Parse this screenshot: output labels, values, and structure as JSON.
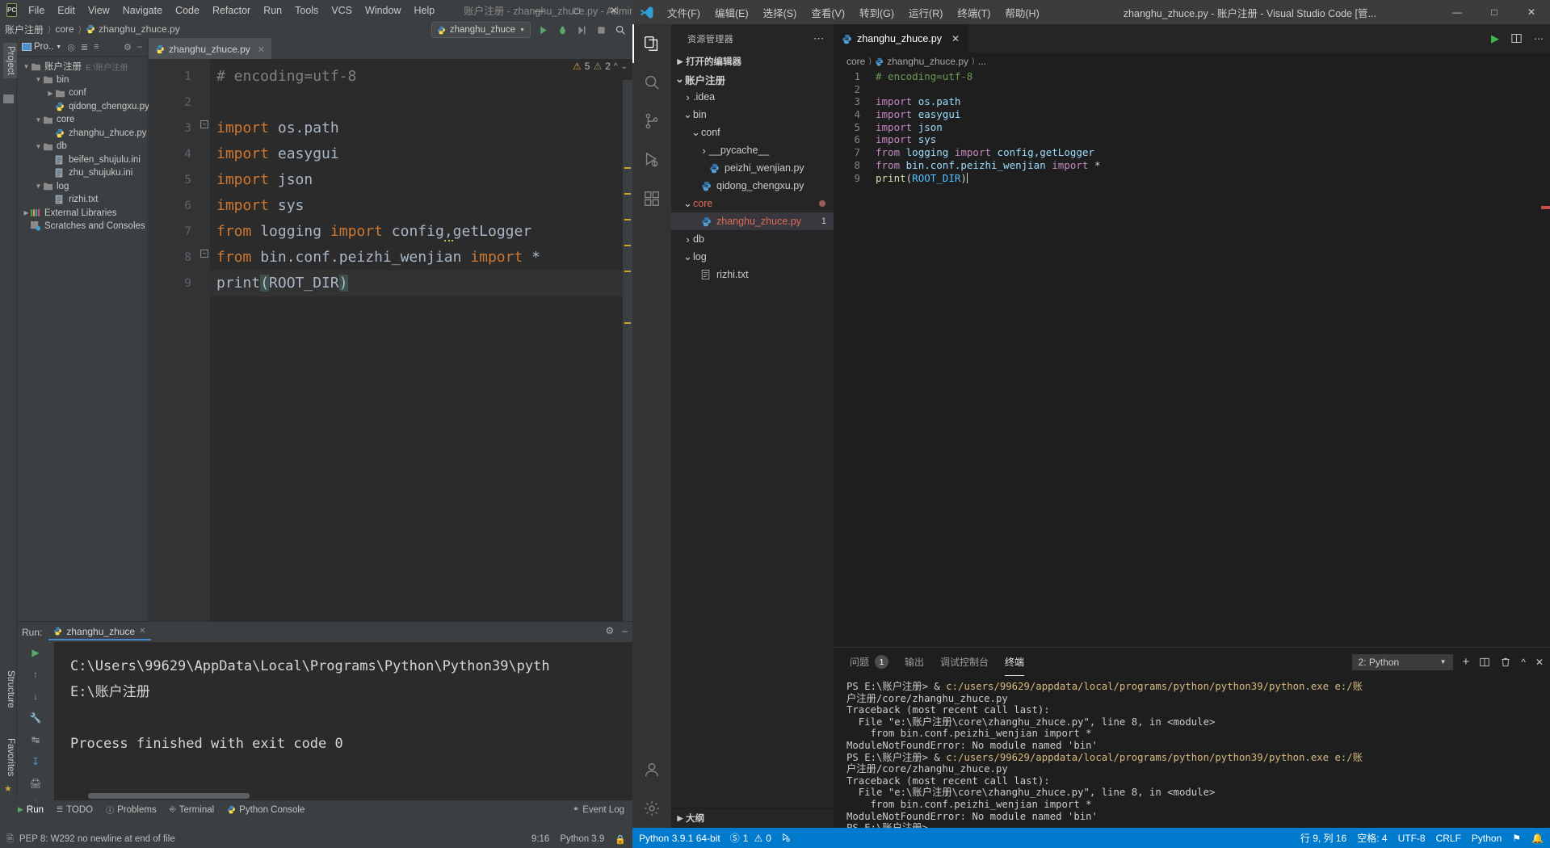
{
  "pycharm": {
    "menu": [
      "File",
      "Edit",
      "View",
      "Navigate",
      "Code",
      "Refactor",
      "Run",
      "Tools",
      "VCS",
      "Window",
      "Help"
    ],
    "title": "账户注册 - zhanghu_zhuce.py - Administrator",
    "breadcrumb": [
      "账户注册",
      "core",
      "zhanghu_zhuce.py"
    ],
    "run_config": "zhanghu_zhuce",
    "project_panel": {
      "title": "Pro.."
    },
    "tree": [
      {
        "indent": 0,
        "arrow": "v",
        "icon": "folder",
        "label": "账户注册",
        "sub": "E:\\账户注册"
      },
      {
        "indent": 1,
        "arrow": "v",
        "icon": "folder",
        "label": "bin",
        "sub": ""
      },
      {
        "indent": 2,
        "arrow": ">",
        "icon": "folder",
        "label": "conf",
        "sub": ""
      },
      {
        "indent": 2,
        "arrow": "",
        "icon": "py",
        "label": "qidong_chengxu.py",
        "sub": ""
      },
      {
        "indent": 1,
        "arrow": "v",
        "icon": "folder",
        "label": "core",
        "sub": ""
      },
      {
        "indent": 2,
        "arrow": "",
        "icon": "py",
        "label": "zhanghu_zhuce.py",
        "sub": ""
      },
      {
        "indent": 1,
        "arrow": "v",
        "icon": "folder",
        "label": "db",
        "sub": ""
      },
      {
        "indent": 2,
        "arrow": "",
        "icon": "ini",
        "label": "beifen_shujulu.ini",
        "sub": ""
      },
      {
        "indent": 2,
        "arrow": "",
        "icon": "ini",
        "label": "zhu_shujuku.ini",
        "sub": ""
      },
      {
        "indent": 1,
        "arrow": "v",
        "icon": "folder",
        "label": "log",
        "sub": ""
      },
      {
        "indent": 2,
        "arrow": "",
        "icon": "ini",
        "label": "rizhi.txt",
        "sub": ""
      },
      {
        "indent": 0,
        "arrow": ">",
        "icon": "lib",
        "label": "External Libraries",
        "sub": ""
      },
      {
        "indent": 0,
        "arrow": "",
        "icon": "scratch",
        "label": "Scratches and Consoles",
        "sub": ""
      }
    ],
    "vertical_tabs": {
      "project": "Project",
      "structure": "Structure",
      "favorites": "Favorites"
    },
    "editor_tab": "zhanghu_zhuce.py",
    "inspections": {
      "warnings": "5",
      "weak_warnings": "2"
    },
    "code_lines": [
      {
        "n": "1",
        "text": "# encoding=utf-8",
        "kind": "comment"
      },
      {
        "n": "2",
        "text": "",
        "kind": "blank"
      },
      {
        "n": "3",
        "text": "import os.path",
        "kind": "import"
      },
      {
        "n": "4",
        "text": "import easygui",
        "kind": "import"
      },
      {
        "n": "5",
        "text": "import json",
        "kind": "import"
      },
      {
        "n": "6",
        "text": "import sys",
        "kind": "import"
      },
      {
        "n": "7",
        "text": "from logging import config,getLogger",
        "kind": "fromimport"
      },
      {
        "n": "8",
        "text": "from bin.conf.peizhi_wenjian import *",
        "kind": "fromimport2"
      },
      {
        "n": "9",
        "text": "print(ROOT_DIR)",
        "kind": "call"
      }
    ],
    "run_panel": {
      "label": "Run:",
      "tab": "zhanghu_zhuce",
      "console": [
        "C:\\Users\\99629\\AppData\\Local\\Programs\\Python\\Python39\\pyth",
        "E:\\账户注册",
        "",
        "Process finished with exit code 0"
      ]
    },
    "tool_windows": [
      "Run",
      "TODO",
      "Problems",
      "Terminal",
      "Python Console"
    ],
    "event_log": "Event Log",
    "status": {
      "message": "PEP 8: W292 no newline at end of file",
      "position": "9:16",
      "interpreter": "Python 3.9"
    }
  },
  "vscode": {
    "menu": [
      "文件(F)",
      "编辑(E)",
      "选择(S)",
      "查看(V)",
      "转到(G)",
      "运行(R)",
      "终端(T)",
      "帮助(H)"
    ],
    "title": "zhanghu_zhuce.py - 账户注册 - Visual Studio Code [管...",
    "sidebar": {
      "header": "资源管理器",
      "open_editors": "打开的编辑器",
      "outline": "大纲",
      "tree": [
        {
          "indent": 0,
          "chev": "v",
          "icon": "",
          "label": "账户注册",
          "bold": true,
          "sel": false,
          "badge": ""
        },
        {
          "indent": 1,
          "chev": ">",
          "icon": "",
          "label": ".idea",
          "bold": false,
          "sel": false,
          "badge": ""
        },
        {
          "indent": 1,
          "chev": "v",
          "icon": "",
          "label": "bin",
          "bold": false,
          "sel": false,
          "badge": ""
        },
        {
          "indent": 2,
          "chev": "v",
          "icon": "",
          "label": "conf",
          "bold": false,
          "sel": false,
          "badge": ""
        },
        {
          "indent": 3,
          "chev": ">",
          "icon": "",
          "label": "__pycache__",
          "bold": false,
          "sel": false,
          "badge": ""
        },
        {
          "indent": 3,
          "chev": "",
          "icon": "py",
          "label": "peizhi_wenjian.py",
          "bold": false,
          "sel": false,
          "badge": ""
        },
        {
          "indent": 2,
          "chev": "",
          "icon": "py",
          "label": "qidong_chengxu.py",
          "bold": false,
          "sel": false,
          "badge": ""
        },
        {
          "indent": 1,
          "chev": "v",
          "icon": "",
          "label": "core",
          "bold": false,
          "sel": false,
          "badge": "dot"
        },
        {
          "indent": 2,
          "chev": "",
          "icon": "py",
          "label": "zhanghu_zhuce.py",
          "bold": false,
          "sel": true,
          "badge": "1"
        },
        {
          "indent": 1,
          "chev": ">",
          "icon": "",
          "label": "db",
          "bold": false,
          "sel": false,
          "badge": ""
        },
        {
          "indent": 1,
          "chev": "v",
          "icon": "",
          "label": "log",
          "bold": false,
          "sel": false,
          "badge": ""
        },
        {
          "indent": 2,
          "chev": "",
          "icon": "ini",
          "label": "rizhi.txt",
          "bold": false,
          "sel": false,
          "badge": ""
        }
      ]
    },
    "editor": {
      "tab": "zhanghu_zhuce.py",
      "breadcrumb": [
        "core",
        "zhanghu_zhuce.py",
        "..."
      ],
      "lines": [
        {
          "n": "1",
          "text": "# encoding=utf-8",
          "kind": "comment"
        },
        {
          "n": "2",
          "text": "",
          "kind": "blank"
        },
        {
          "n": "3",
          "text": "import os.path",
          "kind": "import"
        },
        {
          "n": "4",
          "text": "import easygui",
          "kind": "import"
        },
        {
          "n": "5",
          "text": "import json",
          "kind": "import"
        },
        {
          "n": "6",
          "text": "import sys",
          "kind": "import"
        },
        {
          "n": "7",
          "text": "from logging import config,getLogger",
          "kind": "fromimport"
        },
        {
          "n": "8",
          "text": "from bin.conf.peizhi_wenjian import *",
          "kind": "fromimport2"
        },
        {
          "n": "9",
          "text": "print(ROOT_DIR)",
          "kind": "call"
        }
      ]
    },
    "panel": {
      "tabs": [
        {
          "label": "问题",
          "badge": "1",
          "active": false
        },
        {
          "label": "输出",
          "badge": "",
          "active": false
        },
        {
          "label": "调试控制台",
          "badge": "",
          "active": false
        },
        {
          "label": "终端",
          "badge": "",
          "active": true
        }
      ],
      "terminal_select": "2: Python",
      "terminal_lines": [
        {
          "type": "prompt",
          "ps": "PS E:\\账户注册> ",
          "amp": "& ",
          "cmd": "c:/users/99629/appdata/local/programs/python/python39/python.exe e:/账"
        },
        {
          "type": "plain",
          "text": "户注册/core/zhanghu_zhuce.py"
        },
        {
          "type": "plain",
          "text": "Traceback (most recent call last):"
        },
        {
          "type": "plain",
          "text": "  File \"e:\\账户注册\\core\\zhanghu_zhuce.py\", line 8, in <module>"
        },
        {
          "type": "plain",
          "text": "    from bin.conf.peizhi_wenjian import *"
        },
        {
          "type": "plain",
          "text": "ModuleNotFoundError: No module named 'bin'"
        },
        {
          "type": "prompt",
          "ps": "PS E:\\账户注册> ",
          "amp": "& ",
          "cmd": "c:/users/99629/appdata/local/programs/python/python39/python.exe e:/账"
        },
        {
          "type": "plain",
          "text": "户注册/core/zhanghu_zhuce.py"
        },
        {
          "type": "plain",
          "text": "Traceback (most recent call last):"
        },
        {
          "type": "plain",
          "text": "  File \"e:\\账户注册\\core\\zhanghu_zhuce.py\", line 8, in <module>"
        },
        {
          "type": "plain",
          "text": "    from bin.conf.peizhi_wenjian import *"
        },
        {
          "type": "plain",
          "text": "ModuleNotFoundError: No module named 'bin'"
        },
        {
          "type": "promptonly",
          "ps": "PS E:\\账户注册>"
        }
      ]
    },
    "status": {
      "interpreter": "Python 3.9.1 64-bit",
      "errors": "1",
      "warnings": "0",
      "line_col": "行 9, 列 16",
      "spaces": "空格: 4",
      "encoding": "UTF-8",
      "eol": "CRLF",
      "language": "Python"
    }
  }
}
